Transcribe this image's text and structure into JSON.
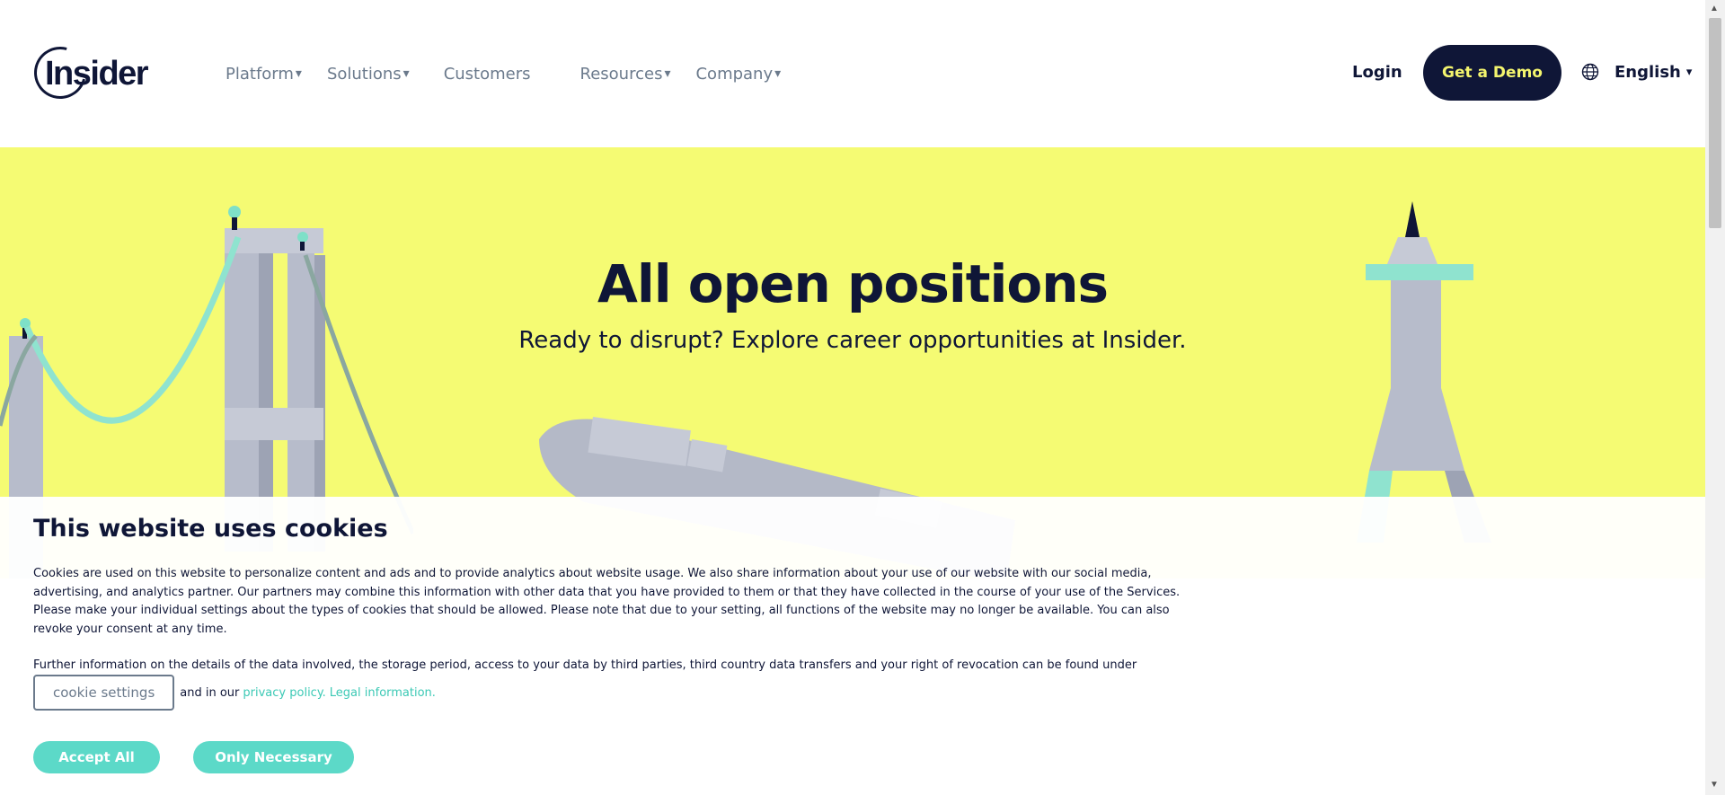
{
  "header": {
    "logo_text": "Insider",
    "nav": [
      {
        "label": "Platform",
        "has_dropdown": true
      },
      {
        "label": "Solutions",
        "has_dropdown": true
      },
      {
        "label": "Customers",
        "has_dropdown": false
      },
      {
        "label": "Resources",
        "has_dropdown": true
      },
      {
        "label": "Company",
        "has_dropdown": true
      }
    ],
    "login_label": "Login",
    "demo_label": "Get a Demo",
    "language_label": "English",
    "caret": "▾"
  },
  "hero": {
    "title": "All open positions",
    "subtitle": "Ready to disrupt? Explore career opportunities at Insider."
  },
  "cookie_banner": {
    "title": "This website uses cookies",
    "body": "Cookies are used on this website to personalize content and ads and to provide analytics about website usage. We also share information about your use of our website with our social media, advertising, and analytics partner. Our partners may combine this information with other data that you have provided to them or that they have collected in the course of your use of the Services. Please make your individual settings about the types of cookies that should be allowed. Please note that due to your setting, all functions of the website may no longer be available. You can also revoke your consent at any time.",
    "further_info": "Further information on the details of the data involved, the storage period, access to your data by third parties, third country data transfers and your right of revocation can be found under",
    "settings_label": "cookie settings",
    "and_text": "and in our",
    "privacy_link": "privacy policy.",
    "legal_link": "Legal information.",
    "accept_label": "Accept All",
    "necessary_label": "Only Necessary"
  },
  "colors": {
    "navy": "#0f1637",
    "hero_yellow": "#f5fb73",
    "demo_text": "#f4f56e",
    "teal": "#5cd9c8",
    "link_teal": "#3cc9b5",
    "nav_gray": "#6b7a8c"
  },
  "scrollbar": {
    "up_arrow": "▲",
    "down_arrow": "▼"
  }
}
